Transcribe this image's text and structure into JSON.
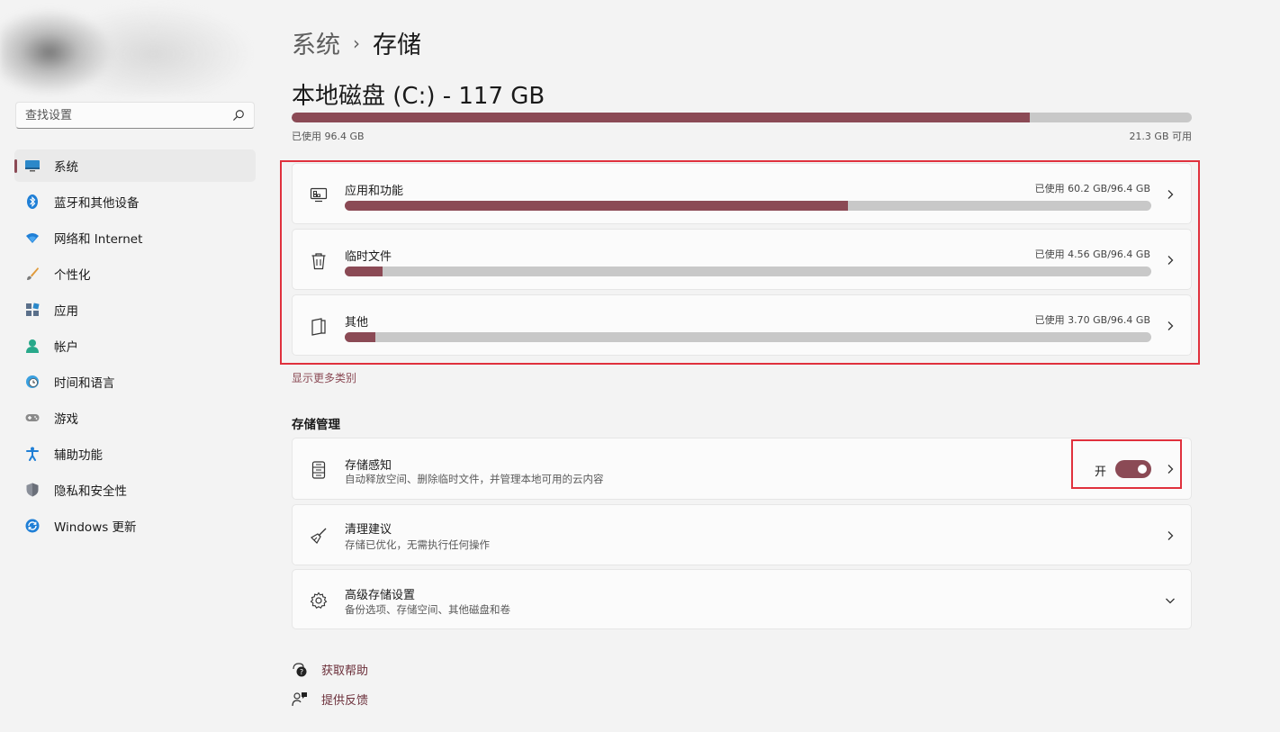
{
  "sidebar": {
    "search_placeholder": "查找设置",
    "items": [
      {
        "label": "系统",
        "icon": "monitor-icon",
        "active": true
      },
      {
        "label": "蓝牙和其他设备",
        "icon": "bluetooth-icon"
      },
      {
        "label": "网络和 Internet",
        "icon": "wifi-icon"
      },
      {
        "label": "个性化",
        "icon": "brush-icon"
      },
      {
        "label": "应用",
        "icon": "apps-icon"
      },
      {
        "label": "帐户",
        "icon": "person-icon"
      },
      {
        "label": "时间和语言",
        "icon": "globe-clock-icon"
      },
      {
        "label": "游戏",
        "icon": "gamepad-icon"
      },
      {
        "label": "辅助功能",
        "icon": "accessibility-icon"
      },
      {
        "label": "隐私和安全性",
        "icon": "shield-icon"
      },
      {
        "label": "Windows 更新",
        "icon": "update-icon"
      }
    ]
  },
  "breadcrumb": {
    "parent": "系统",
    "separator": "›",
    "current": "存储"
  },
  "disk": {
    "title": "本地磁盘 (C:) - 117 GB",
    "used_label": "已使用 96.4 GB",
    "free_label": "21.3 GB 可用",
    "used_fraction": 0.82
  },
  "categories": [
    {
      "title": "应用和功能",
      "usage": "已使用 60.2 GB/96.4 GB",
      "fraction": 0.624,
      "icon": "apps-features-icon"
    },
    {
      "title": "临时文件",
      "usage": "已使用 4.56 GB/96.4 GB",
      "fraction": 0.047,
      "icon": "trash-icon"
    },
    {
      "title": "其他",
      "usage": "已使用 3.70 GB/96.4 GB",
      "fraction": 0.038,
      "icon": "document-icon"
    }
  ],
  "show_more": "显示更多类别",
  "storage_management": {
    "title": "存储管理",
    "storage_sense": {
      "title": "存储感知",
      "subtitle": "自动释放空间、删除临时文件，并管理本地可用的云内容",
      "toggle_label": "开",
      "toggle_on": true
    },
    "cleanup": {
      "title": "清理建议",
      "subtitle": "存储已优化，无需执行任何操作"
    },
    "advanced": {
      "title": "高级存储设置",
      "subtitle": "备份选项、存储空间、其他磁盘和卷"
    }
  },
  "footer": {
    "help": "获取帮助",
    "feedback": "提供反馈"
  },
  "colors": {
    "accent": "#8b4a55",
    "highlight": "#e0313d",
    "bar_bg": "#c8c8c8"
  }
}
